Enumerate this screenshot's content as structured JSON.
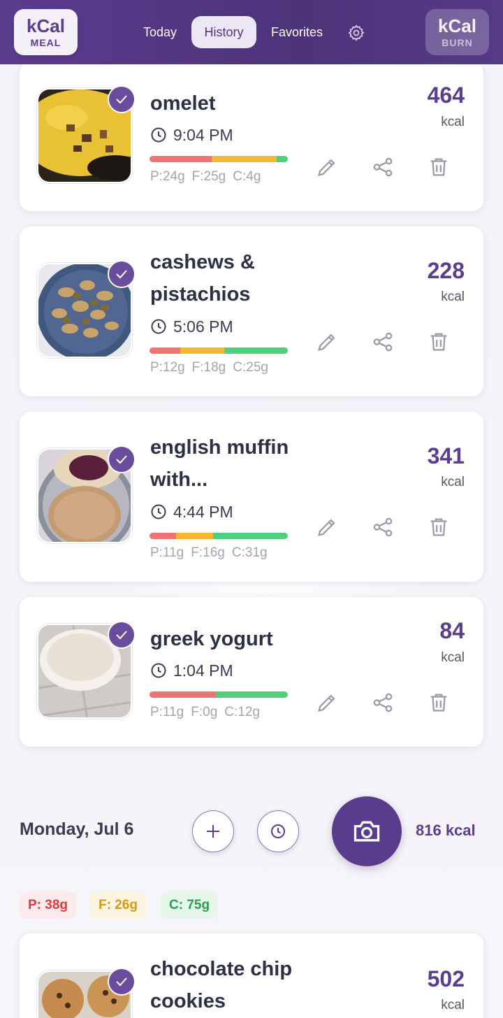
{
  "header": {
    "meal_logo": {
      "top": "kCal",
      "bottom": "MEAL"
    },
    "burn_logo": {
      "top": "kCal",
      "bottom": "BURN"
    },
    "tabs": [
      {
        "label": "Today"
      },
      {
        "label": "History"
      },
      {
        "label": "Favorites"
      }
    ],
    "settings_icon": "gear-icon"
  },
  "meals": [
    {
      "name": "omelet",
      "time": "9:04 PM",
      "kcal": "464",
      "unit": "kcal",
      "protein": "P:24g",
      "fat": "F:25g",
      "carbs": "C:4g",
      "bar": [
        0.45,
        0.47,
        0.08
      ]
    },
    {
      "name": "cashews & pistachios",
      "time": "5:06 PM",
      "kcal": "228",
      "unit": "kcal",
      "protein": "P:12g",
      "fat": "F:18g",
      "carbs": "C:25g",
      "bar": [
        0.22,
        0.32,
        0.46
      ]
    },
    {
      "name": "english muffin with...",
      "time": "4:44 PM",
      "kcal": "341",
      "unit": "kcal",
      "protein": "P:11g",
      "fat": "F:16g",
      "carbs": "C:31g",
      "bar": [
        0.19,
        0.27,
        0.54
      ]
    },
    {
      "name": "greek yogurt",
      "time": "1:04 PM",
      "kcal": "84",
      "unit": "kcal",
      "protein": "P:11g",
      "fat": "F:0g",
      "carbs": "C:12g",
      "bar": [
        0.48,
        0.0,
        0.52
      ]
    },
    {
      "name": "chocolate chip cookies",
      "kcal": "502",
      "unit": "kcal"
    }
  ],
  "day": {
    "title": "Monday, Jul 6",
    "total": "816 kcal",
    "protein": "P: 38g",
    "fat": "F: 26g",
    "carbs": "C: 75g"
  },
  "colors": {
    "accent": "#5a3c8f",
    "protein": "#f07272",
    "fat": "#f5b92e",
    "carbs": "#4fd07a"
  }
}
